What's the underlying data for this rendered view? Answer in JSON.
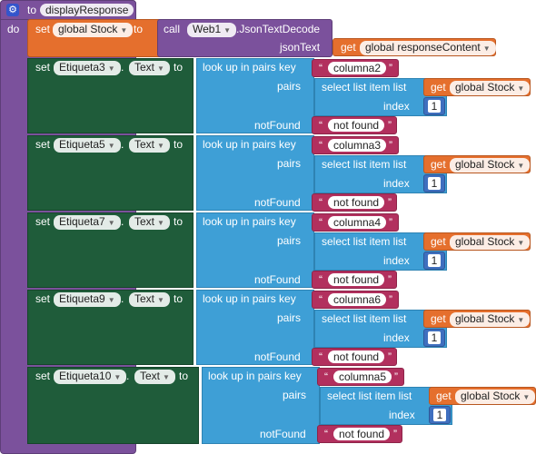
{
  "procedure": {
    "to_label": "to",
    "name": "displayResponse",
    "do_label": "do",
    "gear_glyph": "⚙"
  },
  "set_global": {
    "set_label": "set",
    "var_name": "global Stock",
    "to_label": "to",
    "call_label": "call",
    "component": "Web1",
    "method": ".JsonTextDecode",
    "param_label": "jsonText",
    "get_label": "get",
    "get_var": "global responseContent"
  },
  "common": {
    "set_label": "set",
    "dot": ".",
    "prop": "Text",
    "to_label": "to",
    "lookup_label": "look up in pairs  key",
    "pairs_label": "pairs",
    "select_label": "select list item  list",
    "get_label": "get",
    "get_var": "global Stock",
    "index_label": "index",
    "index_value": "1",
    "notfound_label": "notFound",
    "notfound_value": "not found",
    "open_quote": "“",
    "close_quote": "”"
  },
  "blocks": [
    {
      "component": "Etiqueta3",
      "key": "columna2"
    },
    {
      "component": "Etiqueta5",
      "key": "columna3"
    },
    {
      "component": "Etiqueta7",
      "key": "columna4"
    },
    {
      "component": "Etiqueta9",
      "key": "columna6"
    },
    {
      "component": "Etiqueta10",
      "key": "columna5"
    }
  ],
  "colors": {
    "procedure": "#7b519c",
    "variables": "#e56f2d",
    "component_setter": "#1f5c3a",
    "dictionary": "#3e9fd6",
    "text": "#b2305e",
    "math": "#3f6fbf"
  }
}
